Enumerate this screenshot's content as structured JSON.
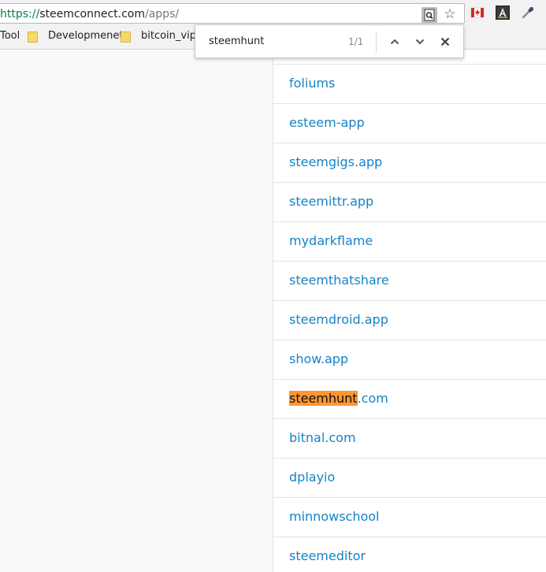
{
  "browser": {
    "url": {
      "scheme": "https://",
      "host": "steemconnect.com",
      "path": "/apps/"
    },
    "bookmarks": [
      {
        "label": "Tool",
        "type": "link"
      },
      {
        "label": "Developmenet",
        "type": "folder"
      },
      {
        "label": "bitcoin_vip",
        "type": "folder"
      }
    ],
    "find_bar": {
      "query": "steemhunt",
      "count": "1/1"
    },
    "icons": [
      "find-in-page-icon",
      "star-icon",
      "ext-canada-icon",
      "ext-typography-icon",
      "ext-eyedropper-icon"
    ],
    "highlight_color": "#ff9632"
  },
  "apps": [
    {
      "name": "foliums",
      "highlight": ""
    },
    {
      "name": "esteem-app",
      "highlight": ""
    },
    {
      "name": "steemgigs.app",
      "highlight": ""
    },
    {
      "name": "steemittr.app",
      "highlight": ""
    },
    {
      "name": "mydarkflame",
      "highlight": ""
    },
    {
      "name": "steemthatshare",
      "highlight": ""
    },
    {
      "name": "steemdroid.app",
      "highlight": ""
    },
    {
      "name": "show.app",
      "highlight": ""
    },
    {
      "name": "steemhunt.com",
      "highlight": "steemhunt"
    },
    {
      "name": "bitnal.com",
      "highlight": ""
    },
    {
      "name": "dplayio",
      "highlight": ""
    },
    {
      "name": "minnowschool",
      "highlight": ""
    },
    {
      "name": "steemeditor",
      "highlight": ""
    }
  ],
  "link_color": "#1583c6"
}
